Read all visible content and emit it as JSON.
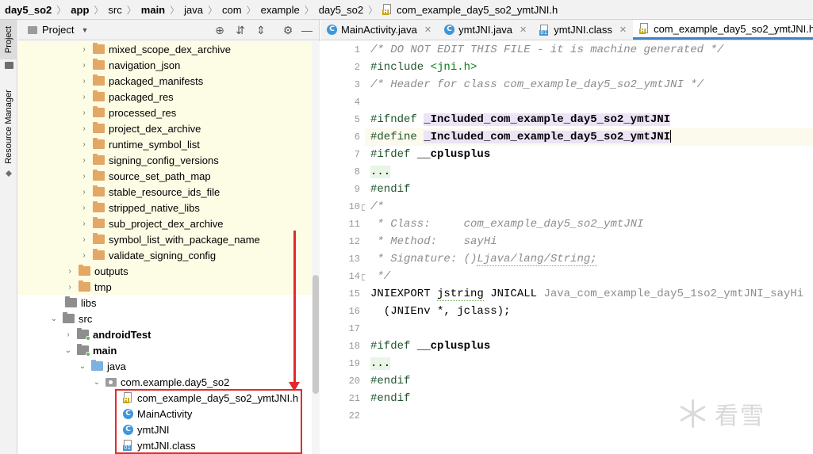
{
  "breadcrumb": [
    "day5_so2",
    "app",
    "src",
    "main",
    "java",
    "com",
    "example",
    "day5_so2",
    "com_example_day5_so2_ymtJNI.h"
  ],
  "left_strip": {
    "project_tab": "Project",
    "resource_tab": "Resource Manager"
  },
  "project_panel": {
    "title": "Project",
    "tree": [
      {
        "label": "mixed_scope_dex_archive"
      },
      {
        "label": "navigation_json"
      },
      {
        "label": "packaged_manifests"
      },
      {
        "label": "packaged_res"
      },
      {
        "label": "processed_res"
      },
      {
        "label": "project_dex_archive"
      },
      {
        "label": "runtime_symbol_list"
      },
      {
        "label": "signing_config_versions"
      },
      {
        "label": "source_set_path_map"
      },
      {
        "label": "stable_resource_ids_file"
      },
      {
        "label": "stripped_native_libs"
      },
      {
        "label": "sub_project_dex_archive"
      },
      {
        "label": "symbol_list_with_package_name"
      },
      {
        "label": "validate_signing_config"
      },
      {
        "label": "outputs"
      },
      {
        "label": "tmp"
      },
      {
        "label": "libs"
      },
      {
        "label": "src"
      },
      {
        "label": "androidTest"
      },
      {
        "label": "main"
      },
      {
        "label": "java"
      },
      {
        "label": "com.example.day5_so2"
      },
      {
        "label": "com_example_day5_so2_ymtJNI.h"
      },
      {
        "label": "MainActivity"
      },
      {
        "label": "ymtJNI"
      },
      {
        "label": "ymtJNI.class"
      }
    ]
  },
  "editor": {
    "tabs": [
      {
        "label": "MainActivity.java"
      },
      {
        "label": "ymtJNI.java"
      },
      {
        "label": "ymtJNI.class"
      },
      {
        "label": "com_example_day5_so2_ymtJNI.h"
      }
    ],
    "line_numbers": [
      "1",
      "2",
      "3",
      "4",
      "5",
      "6",
      "7",
      "8",
      "9",
      "10",
      "11",
      "12",
      "13",
      "14",
      "15",
      "16",
      "17",
      "18",
      "19",
      "20",
      "21",
      "22"
    ],
    "code": {
      "l1": "/* DO NOT EDIT THIS FILE - it is machine generated */",
      "l2a": "#include ",
      "l2b": "<jni.h>",
      "l3": "/* Header for class com_example_day5_so2_ymtJNI */",
      "l5a": "#ifndef ",
      "l5b": "_Included_com_example_day5_so2_ymtJNI",
      "l6a": "#define ",
      "l6b": "_Included_com_example_day5_so2_ymtJNI",
      "l7a": "#ifdef ",
      "l7b": "__cplusplus",
      "l8": "...",
      "l9": "#endif",
      "l10": "/*",
      "l11": " * Class:     com_example_day5_so2_ymtJNI",
      "l12": " * Method:    sayHi",
      "l13a": " * Signature: ()",
      "l13b": "Ljava/lang/String;",
      "l14": " */",
      "l15a": "JNIEXPORT ",
      "l15b": "jstring",
      "l15c": " JNICALL ",
      "l15d": "Java_com_example_day5_1so2_ymtJNI_sayHi",
      "l16": "  (JNIEnv *, jclass);",
      "l18a": "#ifdef ",
      "l18b": "__cplusplus",
      "l19": "...",
      "l20": "#endif",
      "l21": "#endif"
    }
  },
  "watermark": "看雪"
}
